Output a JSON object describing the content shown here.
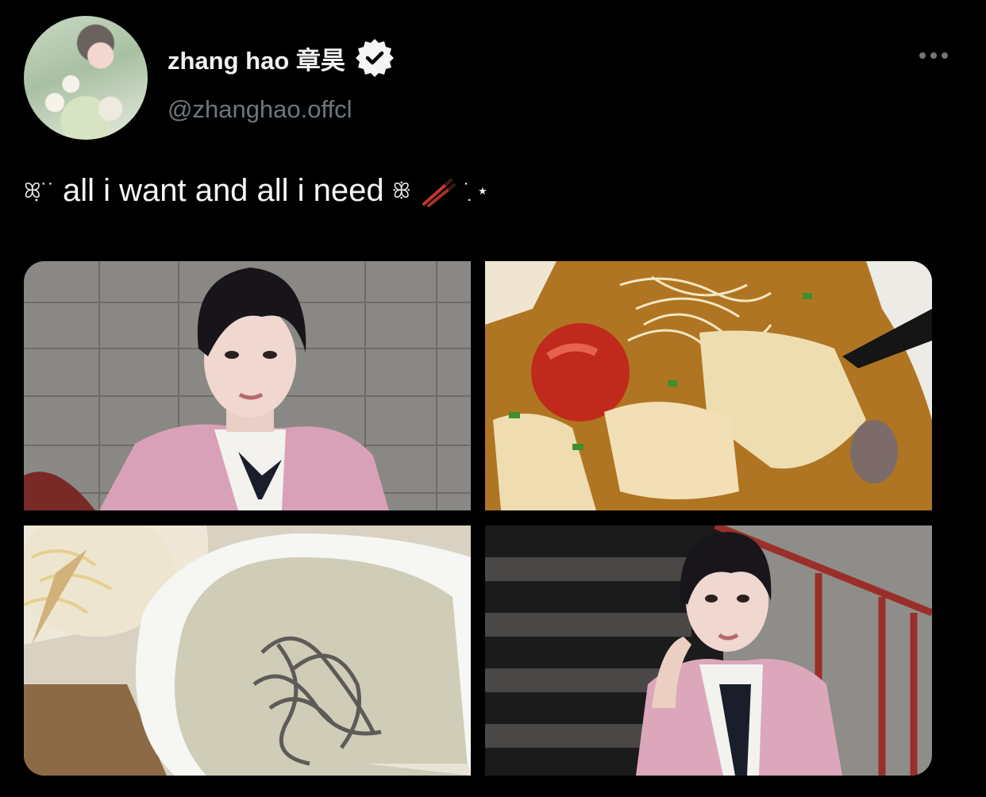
{
  "author": {
    "display_name": "zhang hao 章昊",
    "handle": "@zhanghao.offcl",
    "verified_icon": "verified-badge-icon",
    "more_icon": "more-options-icon"
  },
  "tweet": {
    "prefix_deco": "ꕤ̣˙˙",
    "text": "all i want and all i need",
    "small_deco": "ꕥ",
    "emoji_name": "chopsticks-icon",
    "suffix_deco": "˙ ̣⋆"
  },
  "media": {
    "count": 4,
    "images": [
      {
        "name": "portrait-photo-1"
      },
      {
        "name": "noodle-soup-photo"
      },
      {
        "name": "cream-noodles-photo"
      },
      {
        "name": "portrait-photo-2"
      }
    ]
  },
  "colors": {
    "background": "#000000",
    "handle": "#6f767d",
    "text": "#e7e9ea"
  }
}
